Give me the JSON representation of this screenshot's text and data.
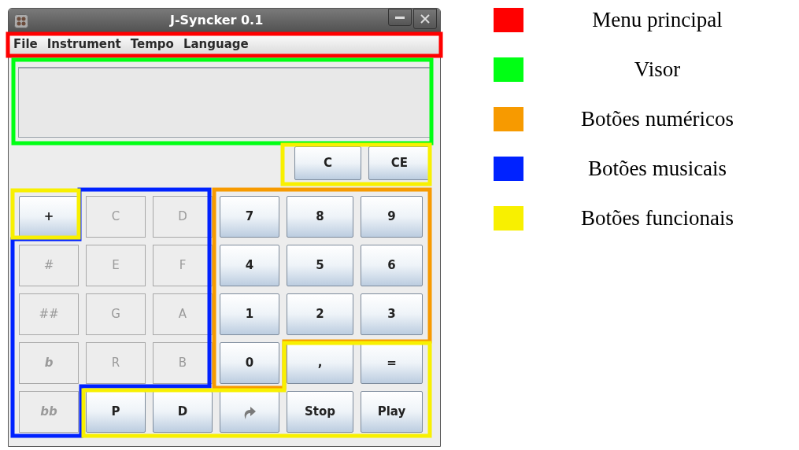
{
  "window": {
    "title": "J-Syncker 0.1"
  },
  "menu": [
    "File",
    "Instrument",
    "Tempo",
    "Language"
  ],
  "top_buttons": [
    {
      "label": "C",
      "disabled": false
    },
    {
      "label": "CE",
      "disabled": false
    }
  ],
  "keypad": [
    {
      "kind": "text",
      "label": "+",
      "disabled": false
    },
    {
      "kind": "text",
      "label": "C",
      "disabled": true
    },
    {
      "kind": "text",
      "label": "D",
      "disabled": true
    },
    {
      "kind": "text",
      "label": "7",
      "disabled": false
    },
    {
      "kind": "text",
      "label": "8",
      "disabled": false
    },
    {
      "kind": "text",
      "label": "9",
      "disabled": false
    },
    {
      "kind": "text",
      "label": "#",
      "disabled": true
    },
    {
      "kind": "text",
      "label": "E",
      "disabled": true
    },
    {
      "kind": "text",
      "label": "F",
      "disabled": true
    },
    {
      "kind": "text",
      "label": "4",
      "disabled": false
    },
    {
      "kind": "text",
      "label": "5",
      "disabled": false
    },
    {
      "kind": "text",
      "label": "6",
      "disabled": false
    },
    {
      "kind": "text",
      "label": "##",
      "disabled": true
    },
    {
      "kind": "text",
      "label": "G",
      "disabled": true
    },
    {
      "kind": "text",
      "label": "A",
      "disabled": true
    },
    {
      "kind": "text",
      "label": "1",
      "disabled": false
    },
    {
      "kind": "text",
      "label": "2",
      "disabled": false
    },
    {
      "kind": "text",
      "label": "3",
      "disabled": false
    },
    {
      "kind": "text",
      "label": "b",
      "disabled": true,
      "italic": true
    },
    {
      "kind": "text",
      "label": "R",
      "disabled": true
    },
    {
      "kind": "text",
      "label": "B",
      "disabled": true
    },
    {
      "kind": "text",
      "label": "0",
      "disabled": false
    },
    {
      "kind": "text",
      "label": ",",
      "disabled": false
    },
    {
      "kind": "text",
      "label": "=",
      "disabled": false
    },
    {
      "kind": "text",
      "label": "bb",
      "disabled": true,
      "italic": true
    },
    {
      "kind": "text",
      "label": "P",
      "disabled": false
    },
    {
      "kind": "text",
      "label": "D",
      "disabled": false
    },
    {
      "kind": "icon",
      "disabled": false
    },
    {
      "kind": "text",
      "label": "Stop",
      "disabled": false
    },
    {
      "kind": "text",
      "label": "Play",
      "disabled": false
    }
  ],
  "legend": [
    {
      "label": "Menu principal",
      "color": "#ff0000"
    },
    {
      "label": "Visor",
      "color": "#00ff14"
    },
    {
      "label": "Botões numéricos",
      "color": "#f79a00"
    },
    {
      "label": "Botões musicais",
      "color": "#0022ff"
    },
    {
      "label": "Botões funcionais",
      "color": "#f8f000"
    }
  ]
}
